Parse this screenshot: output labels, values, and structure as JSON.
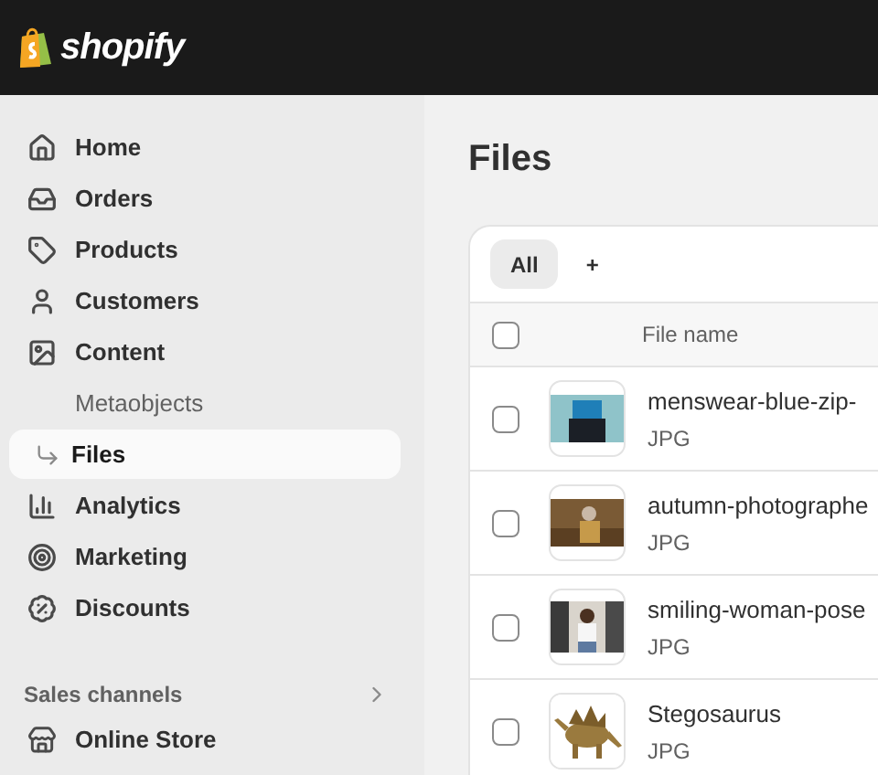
{
  "brand": {
    "name": "shopify"
  },
  "sidebar": {
    "items": [
      {
        "label": "Home",
        "selected": false,
        "kind": "main"
      },
      {
        "label": "Orders",
        "selected": false,
        "kind": "main"
      },
      {
        "label": "Products",
        "selected": false,
        "kind": "main"
      },
      {
        "label": "Customers",
        "selected": false,
        "kind": "main"
      },
      {
        "label": "Content",
        "selected": false,
        "kind": "main"
      },
      {
        "label": "Metaobjects",
        "selected": false,
        "kind": "sub"
      },
      {
        "label": "Files",
        "selected": true,
        "kind": "sub"
      },
      {
        "label": "Analytics",
        "selected": false,
        "kind": "main"
      },
      {
        "label": "Marketing",
        "selected": false,
        "kind": "main"
      },
      {
        "label": "Discounts",
        "selected": false,
        "kind": "main"
      }
    ],
    "sections": [
      {
        "title": "Sales channels",
        "items": [
          {
            "label": "Online Store",
            "selected": false
          }
        ]
      }
    ]
  },
  "page": {
    "title": "Files"
  },
  "tabs": [
    {
      "label": "All",
      "selected": true
    },
    {
      "label": "+",
      "selected": false
    }
  ],
  "table": {
    "select_all_checked": false,
    "columns": [
      "File name"
    ],
    "rows": [
      {
        "name": "menswear-blue-zip-",
        "type": "JPG",
        "checked": false
      },
      {
        "name": "autumn-photographe",
        "type": "JPG",
        "checked": false
      },
      {
        "name": "smiling-woman-pose",
        "type": "JPG",
        "checked": false
      },
      {
        "name": "Stegosaurus",
        "type": "JPG",
        "checked": false
      }
    ]
  }
}
